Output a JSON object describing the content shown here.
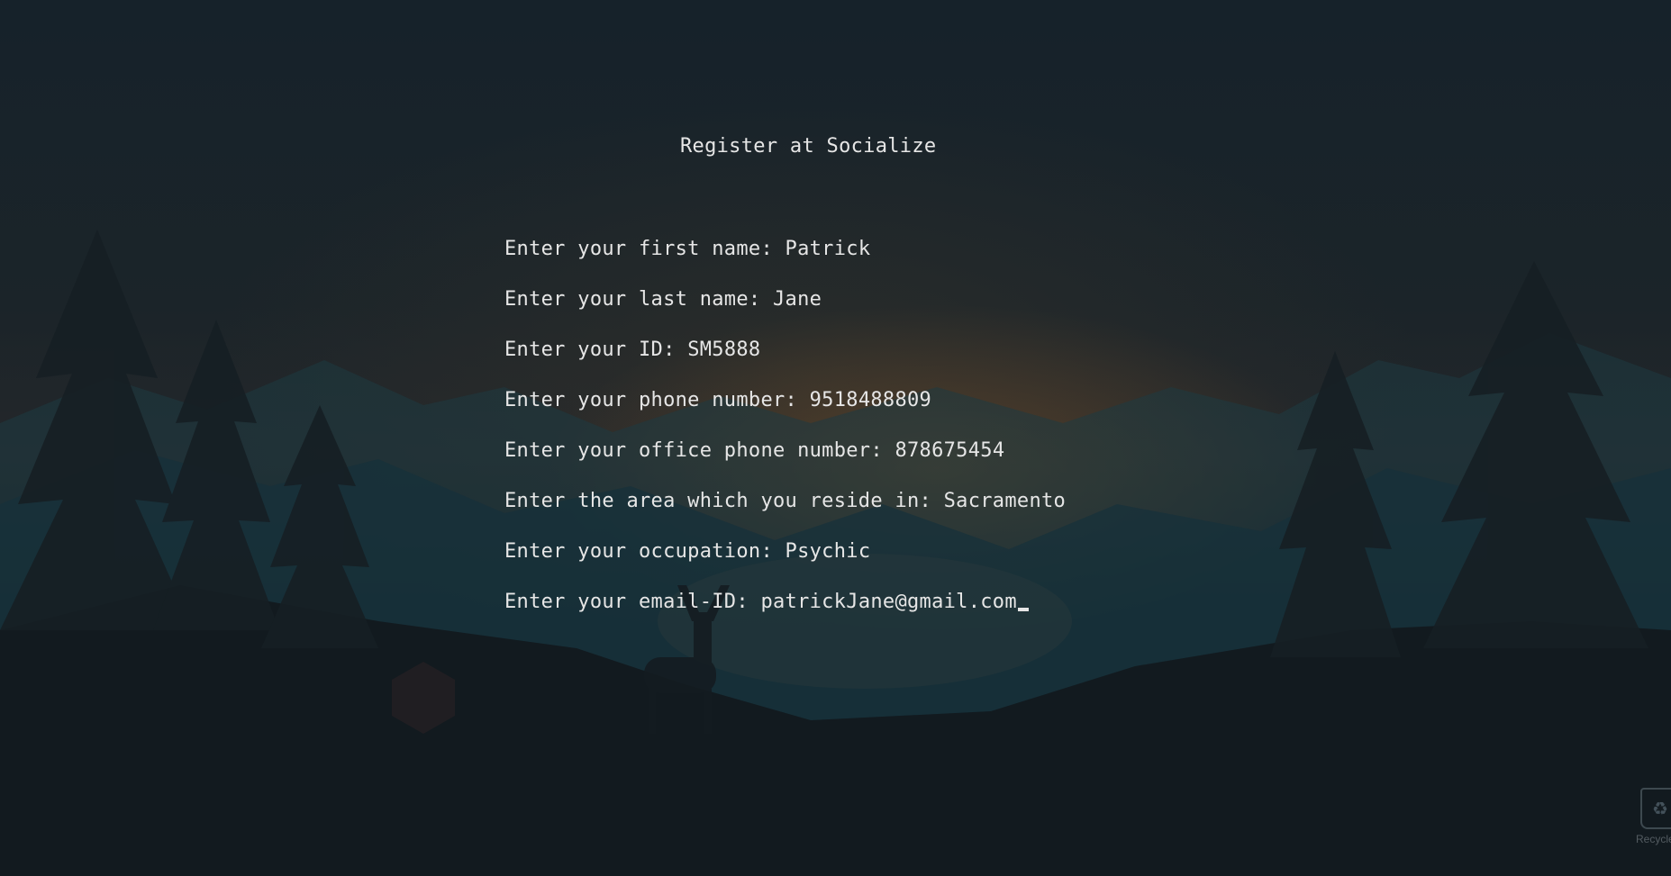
{
  "terminal": {
    "title": "Register at Socialize",
    "prompts": [
      {
        "label": "Enter your first name: ",
        "value": "Patrick"
      },
      {
        "label": "Enter your last name: ",
        "value": "Jane"
      },
      {
        "label": "Enter your ID: ",
        "value": "SM5888"
      },
      {
        "label": "Enter your phone number: ",
        "value": "9518488809"
      },
      {
        "label": "Enter your office phone number: ",
        "value": "878675454"
      },
      {
        "label": "Enter the area which you reside in: ",
        "value": "Sacramento"
      },
      {
        "label": "Enter your occupation: ",
        "value": "Psychic"
      },
      {
        "label": "Enter your email-ID: ",
        "value": "patrickJane@gmail.com"
      }
    ]
  },
  "desktop": {
    "recycle_bin_label": "Recycle B",
    "recycle_bin_icon": "recycle-bin-icon"
  },
  "colors": {
    "text": "#e6e6e6",
    "background": "#141d23"
  }
}
